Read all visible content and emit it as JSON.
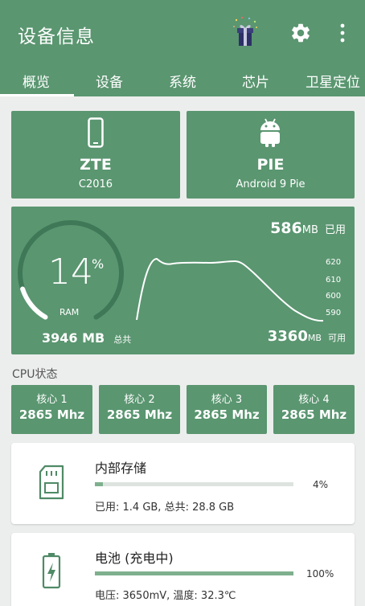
{
  "app": {
    "title": "设备信息"
  },
  "tabs": [
    {
      "label": "概览",
      "active": true
    },
    {
      "label": "设备"
    },
    {
      "label": "系统"
    },
    {
      "label": "芯片"
    },
    {
      "label": "卫星定位"
    }
  ],
  "device_card": {
    "icon": "phone-icon",
    "brand": "ZTE",
    "model": "C2016"
  },
  "os_card": {
    "icon": "android-icon",
    "name": "PIE",
    "version": "Android 9 Pie"
  },
  "ram": {
    "percent": "14",
    "percent_value": 14,
    "percent_sign": "%",
    "label": "RAM",
    "total_value": "3946 MB",
    "total_label": "总共",
    "used_value": "586",
    "used_unit": "MB",
    "used_label": "已用",
    "available_value": "3360",
    "available_unit": "MB",
    "available_label": "可用",
    "axis_ticks": [
      "620",
      "610",
      "600",
      "590"
    ]
  },
  "cpu": {
    "section_label": "CPU状态",
    "cores": [
      {
        "label": "核心 1",
        "freq": "2865 Mhz"
      },
      {
        "label": "核心 2",
        "freq": "2865 Mhz"
      },
      {
        "label": "核心 3",
        "freq": "2865 Mhz"
      },
      {
        "label": "核心 4",
        "freq": "2865 Mhz"
      }
    ]
  },
  "storage": {
    "icon": "sd-card-icon",
    "title": "内部存储",
    "percent_label": "4%",
    "fraction": 0.04,
    "detail": "已用: 1.4 GB,  总共: 28.8 GB"
  },
  "battery": {
    "icon": "battery-charging-icon",
    "title": "电池 (充电中)",
    "percent_label": "100%",
    "fraction": 1.0,
    "detail": "电压: 3650mV,  温度: 32.3℃"
  },
  "colors": {
    "primary": "#5a9670",
    "bar_fill": "#7fb08e",
    "bar_track": "#dde4df",
    "background": "#eceeed"
  }
}
